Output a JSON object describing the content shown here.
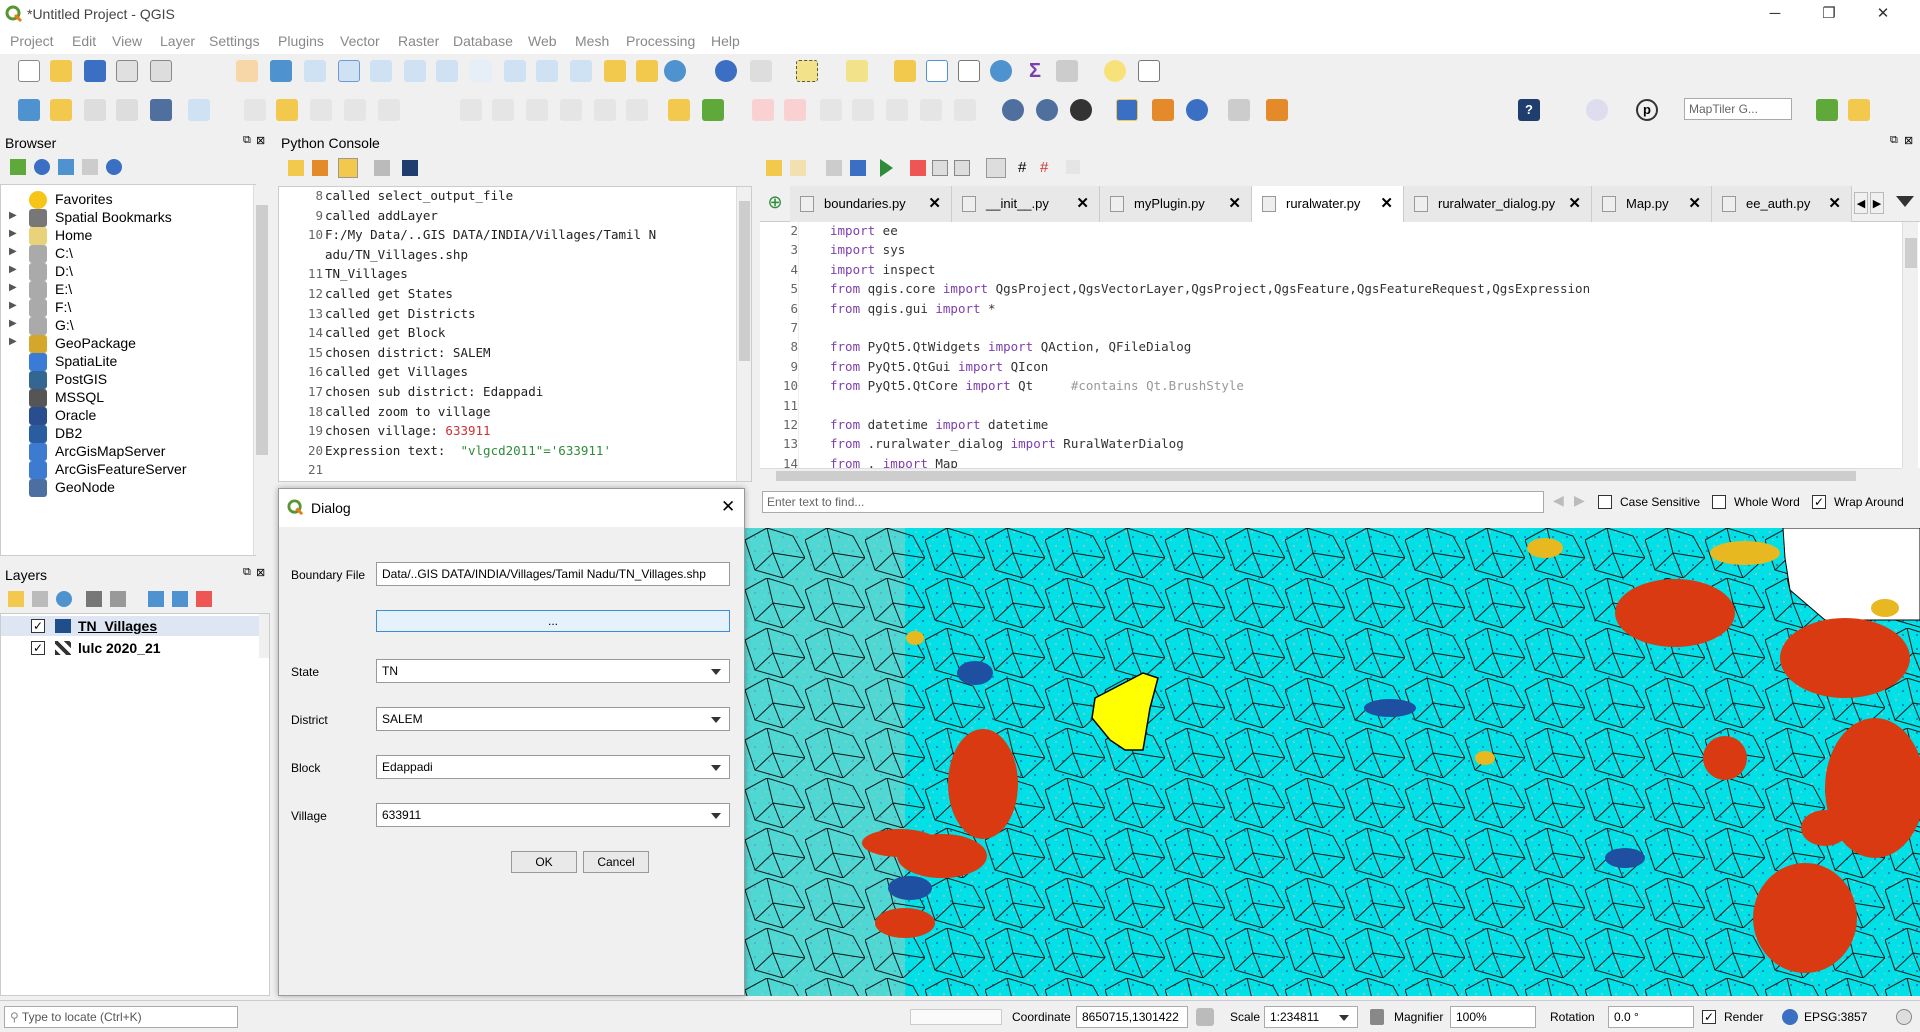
{
  "window": {
    "title": "*Untitled Project - QGIS",
    "minimize": "─",
    "maximize": "❐",
    "close": "✕"
  },
  "menu": [
    "Project",
    "Edit",
    "View",
    "Layer",
    "Settings",
    "Plugins",
    "Vector",
    "Raster",
    "Database",
    "Web",
    "Mesh",
    "Processing",
    "Help"
  ],
  "toolbar": {
    "maptiler_placeholder": "MapTiler G..."
  },
  "browser": {
    "title": "Browser",
    "items": [
      {
        "label": "Favorites",
        "icon": "star-icon",
        "color": "#f5c518"
      },
      {
        "label": "Spatial Bookmarks",
        "icon": "bookmark-icon",
        "color": "#777"
      },
      {
        "label": "Home",
        "icon": "folder-icon",
        "color": "#e8d27a"
      },
      {
        "label": "C:\\",
        "icon": "drive-icon",
        "color": "#aaa"
      },
      {
        "label": "D:\\",
        "icon": "drive-icon",
        "color": "#aaa"
      },
      {
        "label": "E:\\",
        "icon": "drive-icon",
        "color": "#aaa"
      },
      {
        "label": "F:\\",
        "icon": "drive-icon",
        "color": "#aaa"
      },
      {
        "label": "G:\\",
        "icon": "drive-icon",
        "color": "#aaa"
      },
      {
        "label": "GeoPackage",
        "icon": "geopackage-icon",
        "color": "#d4a62b"
      },
      {
        "label": "SpatiaLite",
        "icon": "spatialite-icon",
        "color": "#3a7bd5"
      },
      {
        "label": "PostGIS",
        "icon": "postgis-icon",
        "color": "#336791"
      },
      {
        "label": "MSSQL",
        "icon": "mssql-icon",
        "color": "#555"
      },
      {
        "label": "Oracle",
        "icon": "oracle-icon",
        "color": "#2a4d8f"
      },
      {
        "label": "DB2",
        "icon": "db2-icon",
        "color": "#2a5d9f"
      },
      {
        "label": "ArcGisMapServer",
        "icon": "arcgis-icon",
        "color": "#3c7bd0"
      },
      {
        "label": "ArcGisFeatureServer",
        "icon": "arcgis-icon",
        "color": "#3c7bd0"
      },
      {
        "label": "GeoNode",
        "icon": "geonode-icon",
        "color": "#4a6fa0"
      }
    ]
  },
  "layers": {
    "title": "Layers",
    "items": [
      {
        "label": "TN_Villages",
        "checked": "✓",
        "color": "#1f4e8a"
      },
      {
        "label": "lulc 2020_21",
        "checked": "✓",
        "color": "#333"
      }
    ]
  },
  "console": {
    "title": "Python Console",
    "lines": [
      {
        "n": "8",
        "t": "called select_output_file"
      },
      {
        "n": "9",
        "t": "called addLayer"
      },
      {
        "n": "10",
        "t": "F:/My Data/..GIS DATA/INDIA/Villages/Tamil N"
      },
      {
        "n": "",
        "t": "adu/TN_Villages.shp"
      },
      {
        "n": "11",
        "t": "TN_Villages"
      },
      {
        "n": "12",
        "t": "called get States"
      },
      {
        "n": "13",
        "t": "called get Districts"
      },
      {
        "n": "14",
        "t": "called get Block"
      },
      {
        "n": "15",
        "t": "chosen district: SALEM"
      },
      {
        "n": "16",
        "t": "called get Villages"
      },
      {
        "n": "17",
        "t": "chosen sub district: Edappadi"
      },
      {
        "n": "18",
        "t": "called zoom to village"
      },
      {
        "n": "19",
        "t": "chosen village: ",
        "v": "633911"
      },
      {
        "n": "20",
        "t": "Expression text:  ",
        "v": "\"vlgcd2011\"='633911'"
      },
      {
        "n": "21",
        "t": ""
      }
    ]
  },
  "editor": {
    "tabs": [
      "boundaries.py",
      "__init__.py",
      "myPlugin.py",
      "ruralwater.py",
      "ruralwater_dialog.py",
      "Map.py",
      "ee_auth.py"
    ],
    "lines": [
      {
        "n": "2",
        "k": "import",
        "t": " ee"
      },
      {
        "n": "3",
        "k": "import",
        "t": " sys"
      },
      {
        "n": "4",
        "k": "import",
        "t": " inspect"
      },
      {
        "n": "5",
        "k": "from",
        "t": " qgis.core ",
        "k2": "import",
        "t2": " QgsProject,QgsVectorLayer,QgsProject,QgsFeature,QgsFeatureRequest,QgsExpression"
      },
      {
        "n": "6",
        "k": "from",
        "t": " qgis.gui ",
        "k2": "import",
        "t2": " *"
      },
      {
        "n": "7",
        "k": "",
        "t": ""
      },
      {
        "n": "8",
        "k": "from",
        "t": " PyQt5.QtWidgets ",
        "k2": "import",
        "t2": " QAction, QFileDialog"
      },
      {
        "n": "9",
        "k": "from",
        "t": " PyQt5.QtGui ",
        "k2": "import",
        "t2": " QIcon"
      },
      {
        "n": "10",
        "k": "from",
        "t": " PyQt5.QtCore ",
        "k2": "import",
        "t2": " Qt",
        "c": "     #contains Qt.BrushStyle"
      },
      {
        "n": "11",
        "k": "",
        "t": ""
      },
      {
        "n": "12",
        "k": "from",
        "t": " datetime ",
        "k2": "import",
        "t2": " datetime"
      },
      {
        "n": "13",
        "k": "from",
        "t": " .ruralwater_dialog ",
        "k2": "import",
        "t2": " RuralWaterDialog"
      },
      {
        "n": "14",
        "k": "from",
        "t": " . ",
        "k2": "import",
        "t2": " Map"
      }
    ]
  },
  "find": {
    "placeholder": "Enter text to find...",
    "case": "Case Sensitive",
    "whole": "Whole Word",
    "wrap": "Wrap Around"
  },
  "dialog": {
    "title": "Dialog",
    "boundary_label": "Boundary File",
    "boundary_value": "Data/..GIS DATA/INDIA/Villages/Tamil Nadu/TN_Villages.shp",
    "browse_label": "...",
    "state_label": "State",
    "state_value": "TN",
    "district_label": "District",
    "district_value": "SALEM",
    "block_label": "Block",
    "block_value": "Edappadi",
    "village_label": "Village",
    "village_value": "633911",
    "ok": "OK",
    "cancel": "Cancel"
  },
  "status": {
    "locate_placeholder": "Type to locate (Ctrl+K)",
    "coord_label": "Coordinate",
    "coord_value": "8650715,1301422",
    "scale_label": "Scale",
    "scale_value": "1:234811",
    "magnifier_label": "Magnifier",
    "magnifier_value": "100%",
    "rotation_label": "Rotation",
    "rotation_value": "0.0 °",
    "render_label": "Render",
    "crs_label": "EPSG:3857"
  },
  "colors": {
    "water": "#00e5e8",
    "builtup": "#d93a12",
    "crop": "#e8b820",
    "selected": "#ffff00",
    "urban": "#1f4fa0"
  }
}
